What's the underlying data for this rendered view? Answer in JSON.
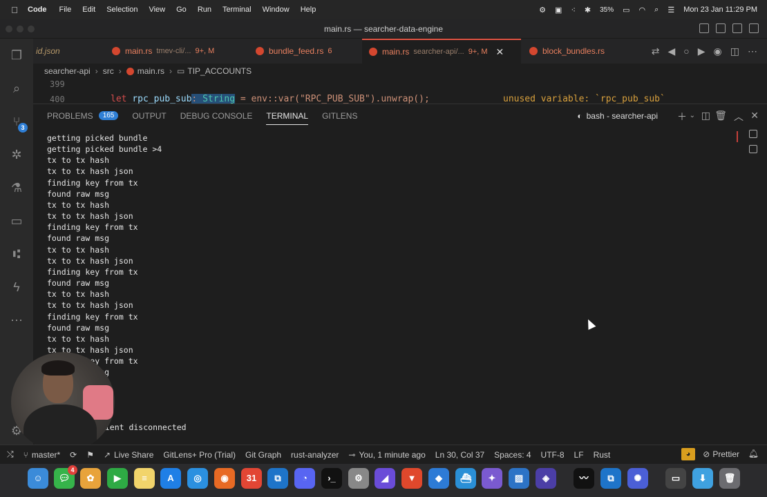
{
  "menubar": {
    "app_name": "Code",
    "items": [
      "File",
      "Edit",
      "Selection",
      "View",
      "Go",
      "Run",
      "Terminal",
      "Window",
      "Help"
    ],
    "battery": "35%",
    "datetime": "Mon 23 Jan  11:29 PM"
  },
  "window": {
    "title": "main.rs — searcher-data-engine"
  },
  "activity": {
    "source_control_badge": "3"
  },
  "tabs": [
    {
      "name": "id.json",
      "desc": "",
      "mod": ""
    },
    {
      "name": "main.rs",
      "desc": "tmev-cli/...",
      "mod": "9+, M"
    },
    {
      "name": "bundle_feed.rs",
      "desc": "",
      "mod": "6"
    },
    {
      "name": "main.rs",
      "desc": "searcher-api/...",
      "mod": "9+, M",
      "close": "✕"
    },
    {
      "name": "block_bundles.rs",
      "desc": "",
      "mod": ""
    }
  ],
  "breadcrumb": {
    "folder": "searcher-api",
    "sub": "src",
    "file": "main.rs",
    "symbol": "TIP_ACCOUNTS"
  },
  "editor": {
    "line_numbers": [
      "399",
      "400"
    ],
    "kw": "let ",
    "var": "rpc_pub_sub",
    "colon": ": ",
    "ty": "String",
    "rest": " = env::var(\"RPC_PUB_SUB\").unwrap();",
    "warning": "unused variable: `rpc_pub_sub`"
  },
  "panel": {
    "problems": "PROBLEMS",
    "problems_count": "165",
    "output": "OUTPUT",
    "debug": "DEBUG CONSOLE",
    "terminal": "TERMINAL",
    "gitlens": "GITLENS",
    "terminal_name": "bash - searcher-api"
  },
  "terminal": {
    "lines": [
      "getting picked bundle",
      "getting picked bundle >4",
      "tx to tx hash",
      "tx to tx hash json",
      "finding key from tx",
      "found raw msg",
      "tx to tx hash",
      "tx to tx hash json",
      "finding key from tx",
      "found raw msg",
      "tx to tx hash",
      "tx to tx hash json",
      "finding key from tx",
      "found raw msg",
      "tx to tx hash",
      "tx to tx hash json",
      "finding key from tx",
      "found raw msg",
      "tx to tx hash",
      "tx to tx hash json",
      "finding key from tx",
      "found raw msg",
      "found bundles"
    ],
    "last_line": "client disconnected"
  },
  "statusbar": {
    "branch": "master*",
    "live_share": "Live Share",
    "gitlens": "GitLens+ Pro (Trial)",
    "git_graph": "Git Graph",
    "analyzer": "rust-analyzer",
    "blame": "You, 1 minute ago",
    "position": "Ln 30, Col 37",
    "spaces": "Spaces: 4",
    "encoding": "UTF-8",
    "eol": "LF",
    "language": "Rust",
    "prettier": "Prettier"
  },
  "dock": {
    "messages_badge": "4",
    "calendar_day": "31"
  },
  "colors": {
    "accent_red": "#e45544",
    "badge_blue": "#2f7fd6",
    "warning": "#d9a13d"
  }
}
